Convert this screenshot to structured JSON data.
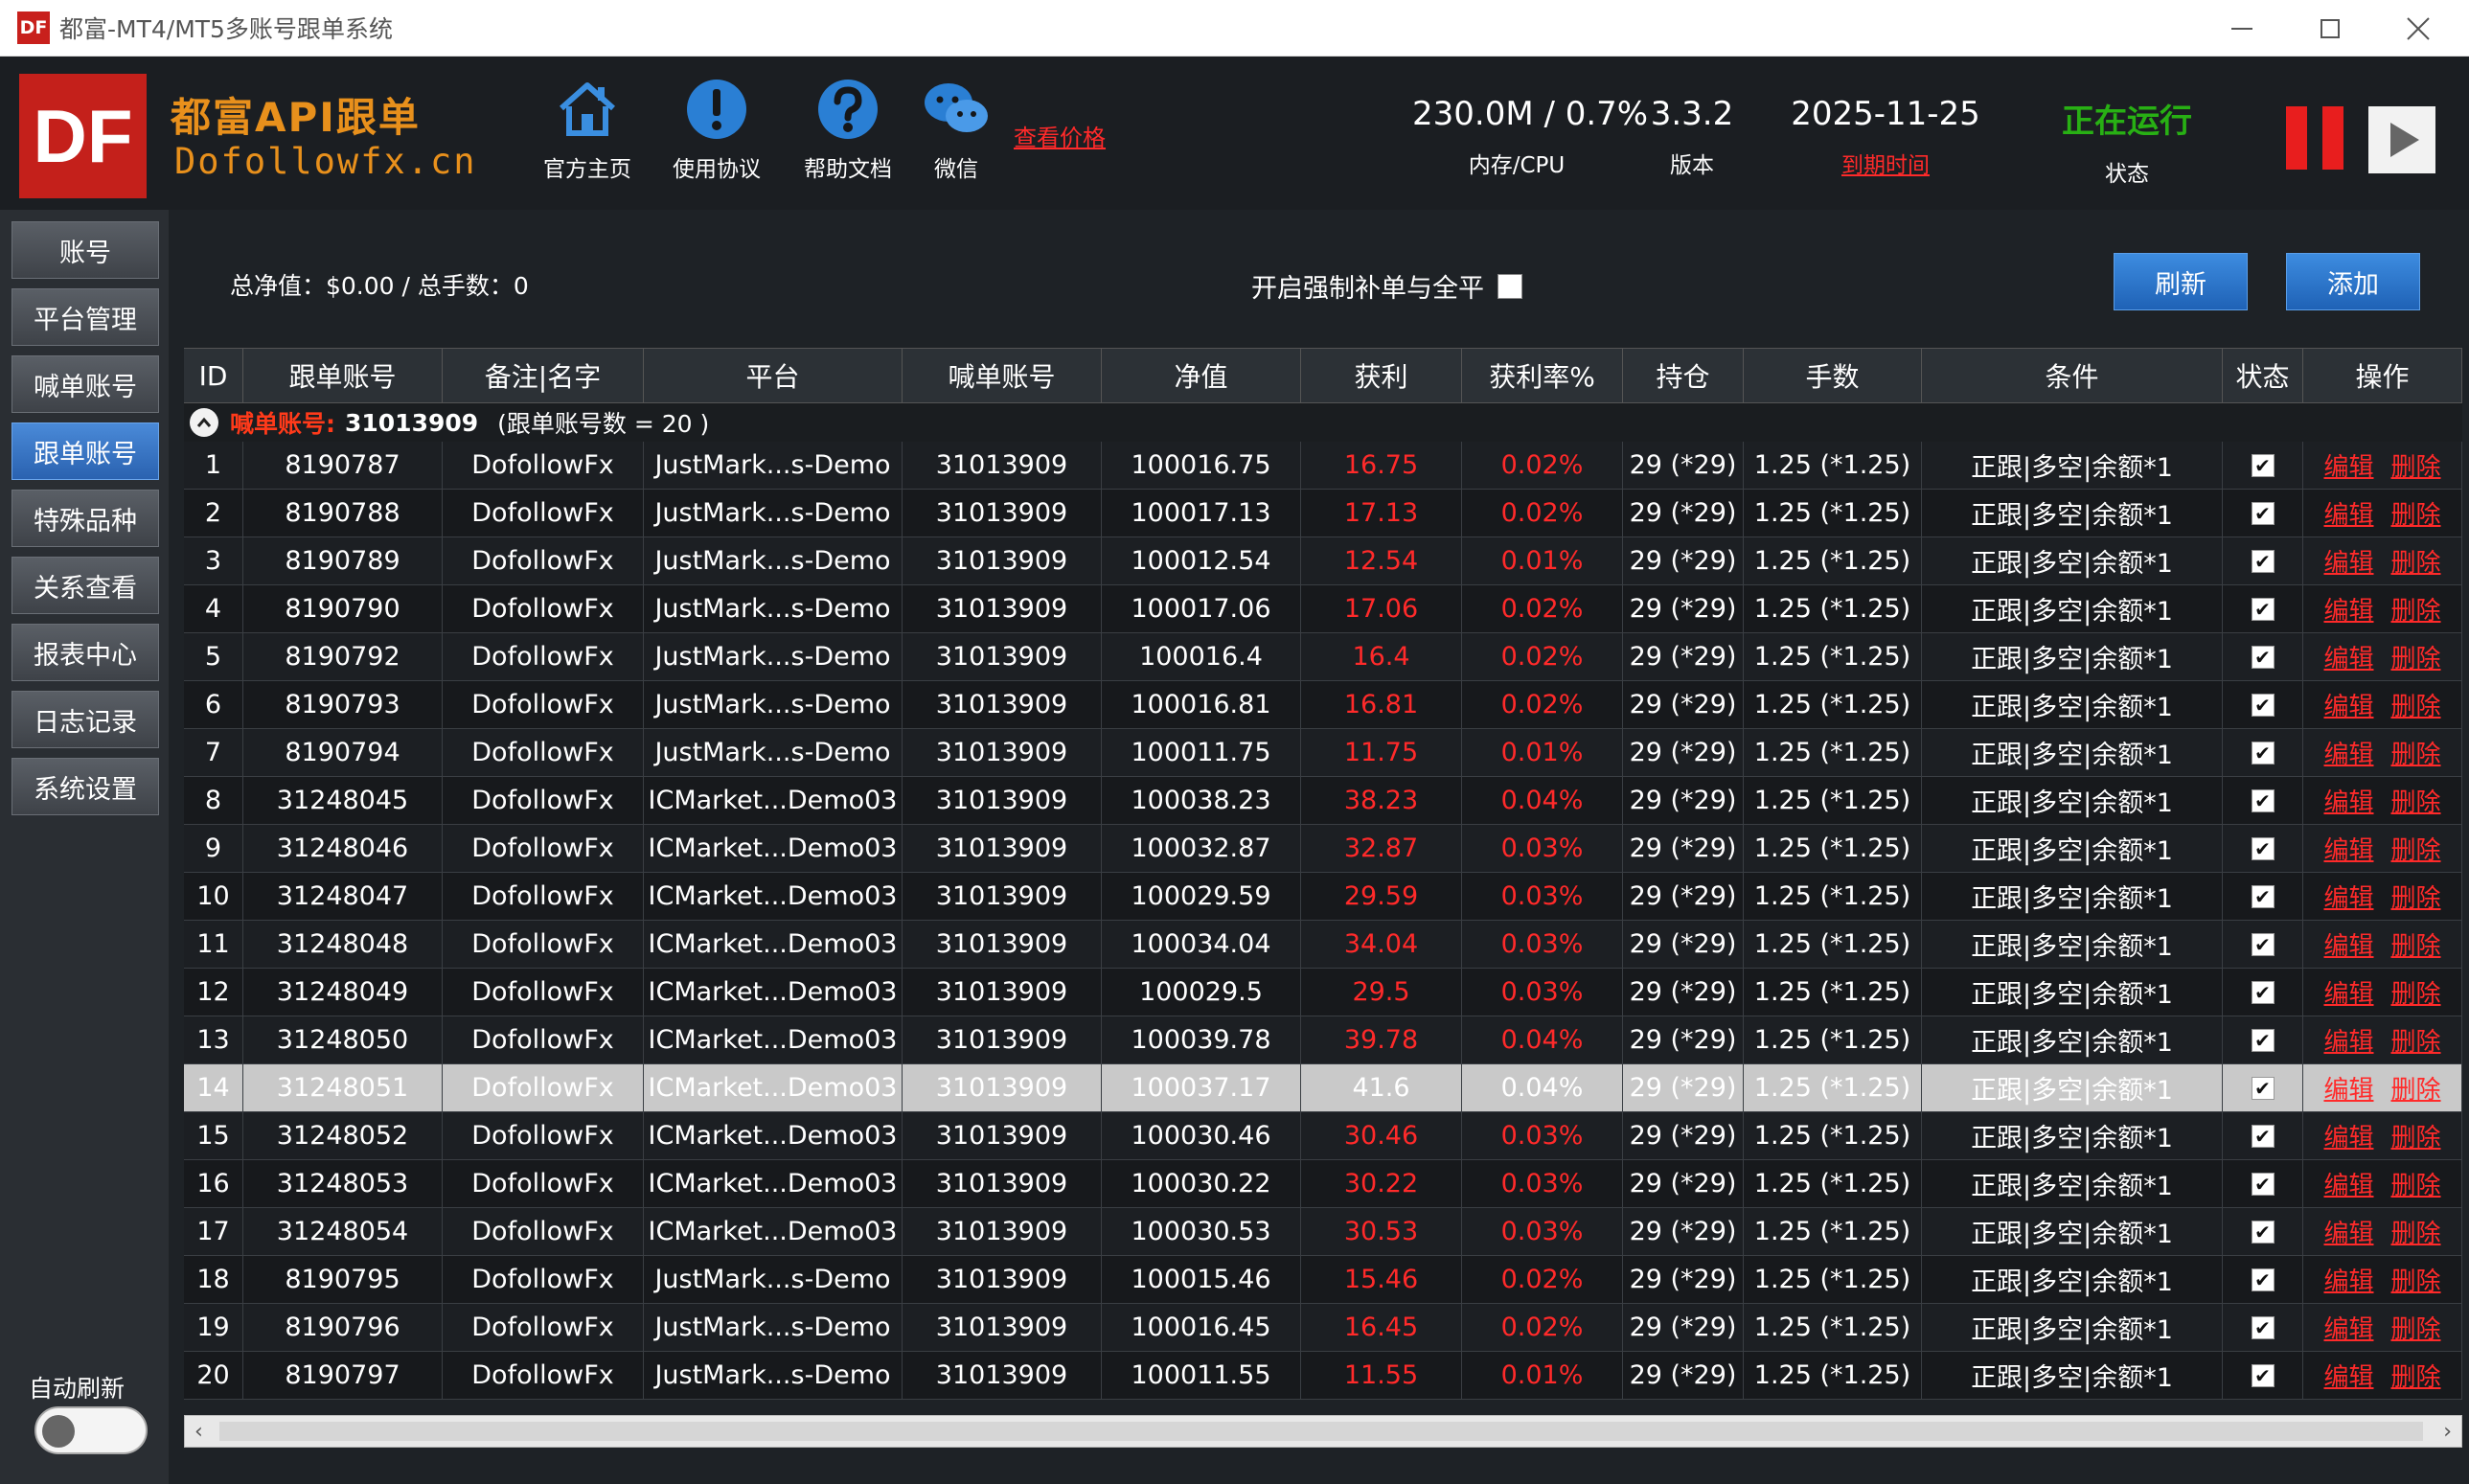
{
  "window": {
    "icon": "DF",
    "title": "都富-MT4/MT5多账号跟单系统"
  },
  "header": {
    "logo": "DF",
    "brand_cn": "都富API跟单",
    "brand_en": "Dofollowfx.cn",
    "nav": [
      {
        "label": "官方主页",
        "icon": "home-icon"
      },
      {
        "label": "使用协议",
        "icon": "exclamation-icon"
      },
      {
        "label": "帮助文档",
        "icon": "question-icon"
      },
      {
        "label": "微信",
        "icon": "wechat-icon"
      }
    ],
    "price_link": "查看价格",
    "stats": {
      "mem_value": "230.0M / 0.7%",
      "mem_label": "内存/CPU",
      "version_value": "3.3.2",
      "version_label": "版本",
      "expire_value": "2025-11-25",
      "expire_label": "到期时间",
      "status_value": "正在运行",
      "status_label": "状态"
    },
    "colors": {
      "brand": "#c4201b",
      "brand_text": "#e8901c",
      "running": "#28b014",
      "alert": "#ff2a2a"
    }
  },
  "sidebar": {
    "items": [
      "账号",
      "平台管理",
      "喊单账号",
      "跟单账号",
      "特殊品种",
      "关系查看",
      "报表中心",
      "日志记录",
      "系统设置"
    ],
    "active_index": 3,
    "auto_refresh_label": "自动刷新",
    "auto_refresh_on": false
  },
  "toolbar": {
    "summary": "总净值：$0.00 / 总手数：0",
    "force_label": "开启强制补单与全平",
    "force_checked": false,
    "refresh_label": "刷新",
    "add_label": "添加"
  },
  "table": {
    "headers": [
      "ID",
      "跟单账号",
      "备注|名字",
      "平台",
      "喊单账号",
      "净值",
      "获利",
      "获利率%",
      "持仓",
      "手数",
      "条件",
      "状态",
      "操作"
    ],
    "group": {
      "label": "喊单账号:",
      "account": "31013909",
      "count_text": "(跟单账号数 = 20 )"
    },
    "edit_label": "编辑",
    "delete_label": "删除",
    "selected_row": 14,
    "rows": [
      {
        "id": "1",
        "acc": "8190787",
        "note": "DofollowFx",
        "plat": "JustMark...s-Demo",
        "master": "31013909",
        "eq": "100016.75",
        "pnl": "16.75",
        "pct": "0.02%",
        "pos": "29 (*29)",
        "lots": "1.25 (*1.25)",
        "cond": "正跟|多空|余额*1",
        "checked": true
      },
      {
        "id": "2",
        "acc": "8190788",
        "note": "DofollowFx",
        "plat": "JustMark...s-Demo",
        "master": "31013909",
        "eq": "100017.13",
        "pnl": "17.13",
        "pct": "0.02%",
        "pos": "29 (*29)",
        "lots": "1.25 (*1.25)",
        "cond": "正跟|多空|余额*1",
        "checked": true
      },
      {
        "id": "3",
        "acc": "8190789",
        "note": "DofollowFx",
        "plat": "JustMark...s-Demo",
        "master": "31013909",
        "eq": "100012.54",
        "pnl": "12.54",
        "pct": "0.01%",
        "pos": "29 (*29)",
        "lots": "1.25 (*1.25)",
        "cond": "正跟|多空|余额*1",
        "checked": true
      },
      {
        "id": "4",
        "acc": "8190790",
        "note": "DofollowFx",
        "plat": "JustMark...s-Demo",
        "master": "31013909",
        "eq": "100017.06",
        "pnl": "17.06",
        "pct": "0.02%",
        "pos": "29 (*29)",
        "lots": "1.25 (*1.25)",
        "cond": "正跟|多空|余额*1",
        "checked": true
      },
      {
        "id": "5",
        "acc": "8190792",
        "note": "DofollowFx",
        "plat": "JustMark...s-Demo",
        "master": "31013909",
        "eq": "100016.4",
        "pnl": "16.4",
        "pct": "0.02%",
        "pos": "29 (*29)",
        "lots": "1.25 (*1.25)",
        "cond": "正跟|多空|余额*1",
        "checked": true
      },
      {
        "id": "6",
        "acc": "8190793",
        "note": "DofollowFx",
        "plat": "JustMark...s-Demo",
        "master": "31013909",
        "eq": "100016.81",
        "pnl": "16.81",
        "pct": "0.02%",
        "pos": "29 (*29)",
        "lots": "1.25 (*1.25)",
        "cond": "正跟|多空|余额*1",
        "checked": true
      },
      {
        "id": "7",
        "acc": "8190794",
        "note": "DofollowFx",
        "plat": "JustMark...s-Demo",
        "master": "31013909",
        "eq": "100011.75",
        "pnl": "11.75",
        "pct": "0.01%",
        "pos": "29 (*29)",
        "lots": "1.25 (*1.25)",
        "cond": "正跟|多空|余额*1",
        "checked": true
      },
      {
        "id": "8",
        "acc": "31248045",
        "note": "DofollowFx",
        "plat": "ICMarket...Demo03",
        "master": "31013909",
        "eq": "100038.23",
        "pnl": "38.23",
        "pct": "0.04%",
        "pos": "29 (*29)",
        "lots": "1.25 (*1.25)",
        "cond": "正跟|多空|余额*1",
        "checked": true
      },
      {
        "id": "9",
        "acc": "31248046",
        "note": "DofollowFx",
        "plat": "ICMarket...Demo03",
        "master": "31013909",
        "eq": "100032.87",
        "pnl": "32.87",
        "pct": "0.03%",
        "pos": "29 (*29)",
        "lots": "1.25 (*1.25)",
        "cond": "正跟|多空|余额*1",
        "checked": true
      },
      {
        "id": "10",
        "acc": "31248047",
        "note": "DofollowFx",
        "plat": "ICMarket...Demo03",
        "master": "31013909",
        "eq": "100029.59",
        "pnl": "29.59",
        "pct": "0.03%",
        "pos": "29 (*29)",
        "lots": "1.25 (*1.25)",
        "cond": "正跟|多空|余额*1",
        "checked": true
      },
      {
        "id": "11",
        "acc": "31248048",
        "note": "DofollowFx",
        "plat": "ICMarket...Demo03",
        "master": "31013909",
        "eq": "100034.04",
        "pnl": "34.04",
        "pct": "0.03%",
        "pos": "29 (*29)",
        "lots": "1.25 (*1.25)",
        "cond": "正跟|多空|余额*1",
        "checked": true
      },
      {
        "id": "12",
        "acc": "31248049",
        "note": "DofollowFx",
        "plat": "ICMarket...Demo03",
        "master": "31013909",
        "eq": "100029.5",
        "pnl": "29.5",
        "pct": "0.03%",
        "pos": "29 (*29)",
        "lots": "1.25 (*1.25)",
        "cond": "正跟|多空|余额*1",
        "checked": true
      },
      {
        "id": "13",
        "acc": "31248050",
        "note": "DofollowFx",
        "plat": "ICMarket...Demo03",
        "master": "31013909",
        "eq": "100039.78",
        "pnl": "39.78",
        "pct": "0.04%",
        "pos": "29 (*29)",
        "lots": "1.25 (*1.25)",
        "cond": "正跟|多空|余额*1",
        "checked": true
      },
      {
        "id": "14",
        "acc": "31248051",
        "note": "DofollowFx",
        "plat": "ICMarket...Demo03",
        "master": "31013909",
        "eq": "100037.17",
        "pnl": "41.6",
        "pct": "0.04%",
        "pos": "29 (*29)",
        "lots": "1.25 (*1.25)",
        "cond": "正跟|多空|余额*1",
        "checked": true
      },
      {
        "id": "15",
        "acc": "31248052",
        "note": "DofollowFx",
        "plat": "ICMarket...Demo03",
        "master": "31013909",
        "eq": "100030.46",
        "pnl": "30.46",
        "pct": "0.03%",
        "pos": "29 (*29)",
        "lots": "1.25 (*1.25)",
        "cond": "正跟|多空|余额*1",
        "checked": true
      },
      {
        "id": "16",
        "acc": "31248053",
        "note": "DofollowFx",
        "plat": "ICMarket...Demo03",
        "master": "31013909",
        "eq": "100030.22",
        "pnl": "30.22",
        "pct": "0.03%",
        "pos": "29 (*29)",
        "lots": "1.25 (*1.25)",
        "cond": "正跟|多空|余额*1",
        "checked": true
      },
      {
        "id": "17",
        "acc": "31248054",
        "note": "DofollowFx",
        "plat": "ICMarket...Demo03",
        "master": "31013909",
        "eq": "100030.53",
        "pnl": "30.53",
        "pct": "0.03%",
        "pos": "29 (*29)",
        "lots": "1.25 (*1.25)",
        "cond": "正跟|多空|余额*1",
        "checked": true
      },
      {
        "id": "18",
        "acc": "8190795",
        "note": "DofollowFx",
        "plat": "JustMark...s-Demo",
        "master": "31013909",
        "eq": "100015.46",
        "pnl": "15.46",
        "pct": "0.02%",
        "pos": "29 (*29)",
        "lots": "1.25 (*1.25)",
        "cond": "正跟|多空|余额*1",
        "checked": true
      },
      {
        "id": "19",
        "acc": "8190796",
        "note": "DofollowFx",
        "plat": "JustMark...s-Demo",
        "master": "31013909",
        "eq": "100016.45",
        "pnl": "16.45",
        "pct": "0.02%",
        "pos": "29 (*29)",
        "lots": "1.25 (*1.25)",
        "cond": "正跟|多空|余额*1",
        "checked": true
      },
      {
        "id": "20",
        "acc": "8190797",
        "note": "DofollowFx",
        "plat": "JustMark...s-Demo",
        "master": "31013909",
        "eq": "100011.55",
        "pnl": "11.55",
        "pct": "0.01%",
        "pos": "29 (*29)",
        "lots": "1.25 (*1.25)",
        "cond": "正跟|多空|余额*1",
        "checked": true
      }
    ]
  }
}
